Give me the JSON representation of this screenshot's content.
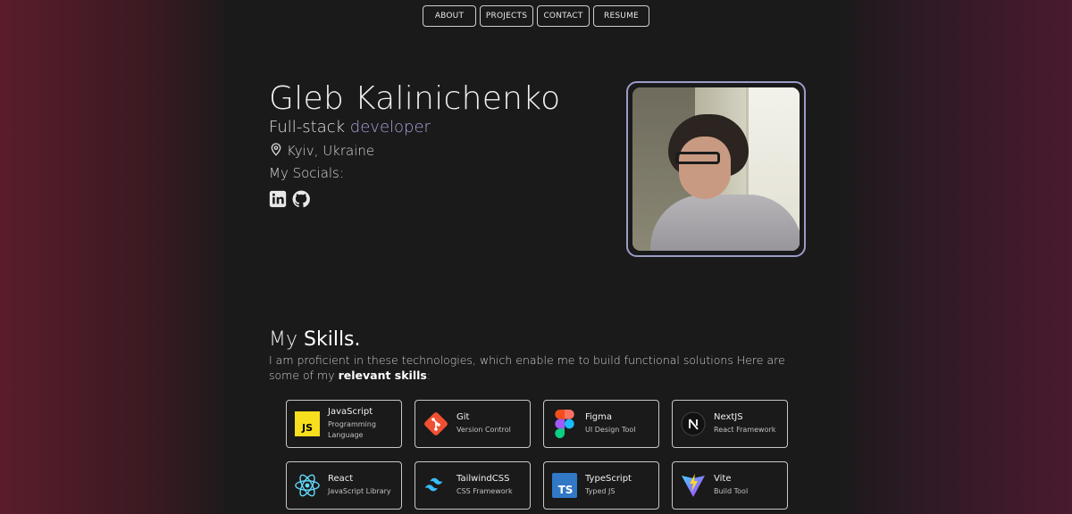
{
  "nav": [
    "ABOUT",
    "PROJECTS",
    "CONTACT",
    "RESUME"
  ],
  "hero": {
    "name": "Gleb Kalinichenko",
    "role_prefix": "Full-stack",
    "role_accent": "developer",
    "location": "Kyiv, Ukraine",
    "socials_label": "My Socials:",
    "socials": [
      "linkedin-icon",
      "github-icon"
    ]
  },
  "skills": {
    "title_prefix": "My",
    "title_bold": "Skills.",
    "desc_prefix": "I am proficient in these technologies, which enable me to build functional solutions Here are some of my",
    "desc_bold": "relevant skills",
    "desc_suffix": ":",
    "items": [
      {
        "name": "JavaScript",
        "sub": "Programming Language",
        "icon": "javascript-icon",
        "color": "#f7df1e"
      },
      {
        "name": "Git",
        "sub": "Version Control",
        "icon": "git-icon",
        "color": "#f05032"
      },
      {
        "name": "Figma",
        "sub": "UI Design Tool",
        "icon": "figma-icon",
        "color": "#a259ff"
      },
      {
        "name": "NextJS",
        "sub": "React Framework",
        "icon": "nextjs-icon",
        "color": "#000000"
      },
      {
        "name": "React",
        "sub": "JavaScript Library",
        "icon": "react-icon",
        "color": "#61dafb"
      },
      {
        "name": "TailwindCSS",
        "sub": "CSS Framework",
        "icon": "tailwind-icon",
        "color": "#38bdf8"
      },
      {
        "name": "TypeScript",
        "sub": "Typed JS",
        "icon": "typescript-icon",
        "color": "#3178c6"
      },
      {
        "name": "Vite",
        "sub": "Build Tool",
        "icon": "vite-icon",
        "color": "#646cff"
      }
    ]
  }
}
